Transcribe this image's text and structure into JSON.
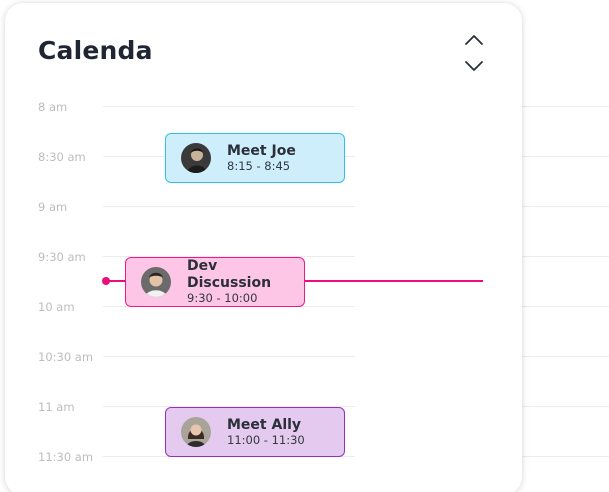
{
  "header": {
    "title": "Calenda"
  },
  "nav": {
    "up_icon": "chevron-up-icon",
    "down_icon": "chevron-down-icon"
  },
  "times": [
    "8 am",
    "8:30 am",
    "9 am",
    "9:30 am",
    "10 am",
    "10:30 am",
    "11 am",
    "11:30 am"
  ],
  "events": [
    {
      "title": "Meet Joe",
      "time": "8:15 - 8:45",
      "color": "#cdeefa",
      "border": "#31c2e2",
      "avatar": "avatar-joe"
    },
    {
      "title": "Dev Discussion",
      "time": "9:30 - 10:00",
      "color": "#fdc6e6",
      "border": "#ea1b85",
      "avatar": "avatar-dev"
    },
    {
      "title": "Meet Ally",
      "time": "11:00 - 11:30",
      "color": "#e4caef",
      "border": "#9a2fbf",
      "avatar": "avatar-ally"
    }
  ],
  "colors": {
    "now_indicator": "#ea0d7a",
    "title_text": "#1f2533",
    "time_label": "#bdbdbd"
  }
}
